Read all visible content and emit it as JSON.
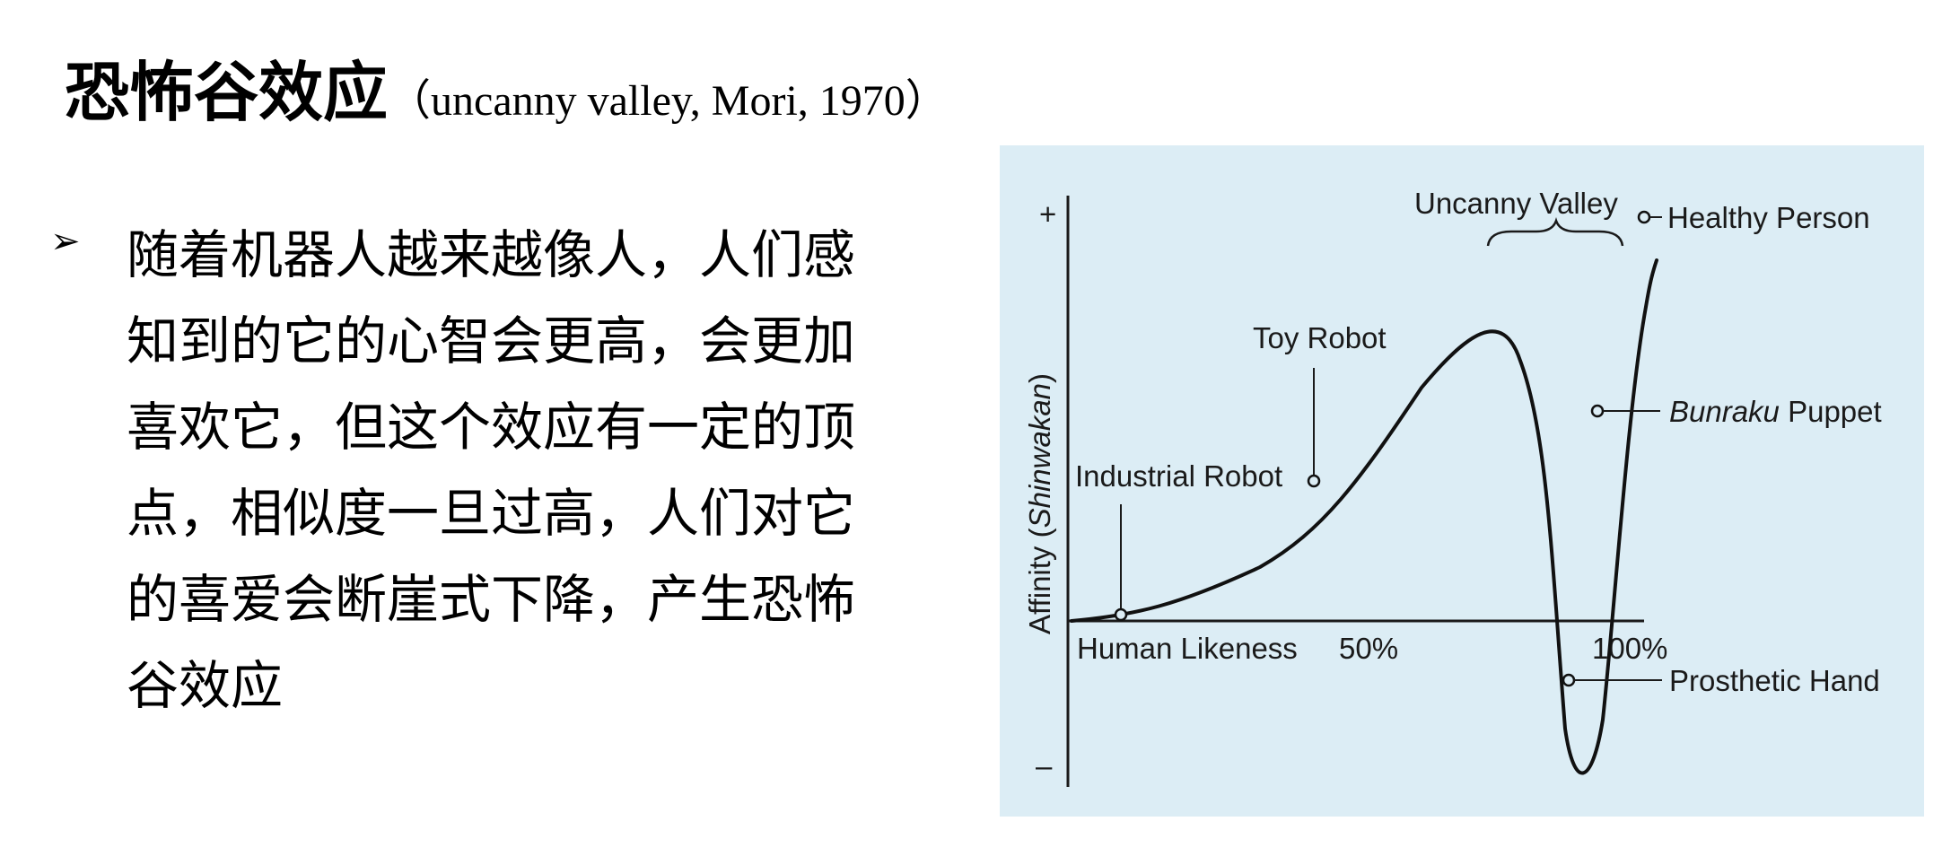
{
  "slide": {
    "title_main": "恐怖谷效应",
    "title_sub": "（uncanny valley, Mori, 1970）",
    "bullet_icon": "arrowhead-bullet-icon",
    "bullet_text": "随着机器人越来越像人，人们感知到的它的心智会更高，会更加喜欢它，但这个效应有一定的顶点，相似度一旦过高，人们对它的喜爱会断崖式下降，产生恐怖谷效应"
  },
  "figure": {
    "background_color": "#dcedf5",
    "y_plus": "+",
    "y_minus": "–",
    "y_axis_label_prefix": "Affinity (",
    "y_axis_label_italic": "Shinwakan",
    "y_axis_label_suffix": ")",
    "x_axis_label": "Human Likeness",
    "x_tick_50": "50%",
    "x_tick_100": "100%",
    "brace_label": "Uncanny Valley",
    "points": {
      "industrial_robot": "Industrial Robot",
      "toy_robot": "Toy Robot",
      "healthy_person": "Healthy Person",
      "bunraku_italic": "Bunraku",
      "bunraku_suffix": " Puppet",
      "prosthetic_hand": "Prosthetic Hand"
    }
  }
}
